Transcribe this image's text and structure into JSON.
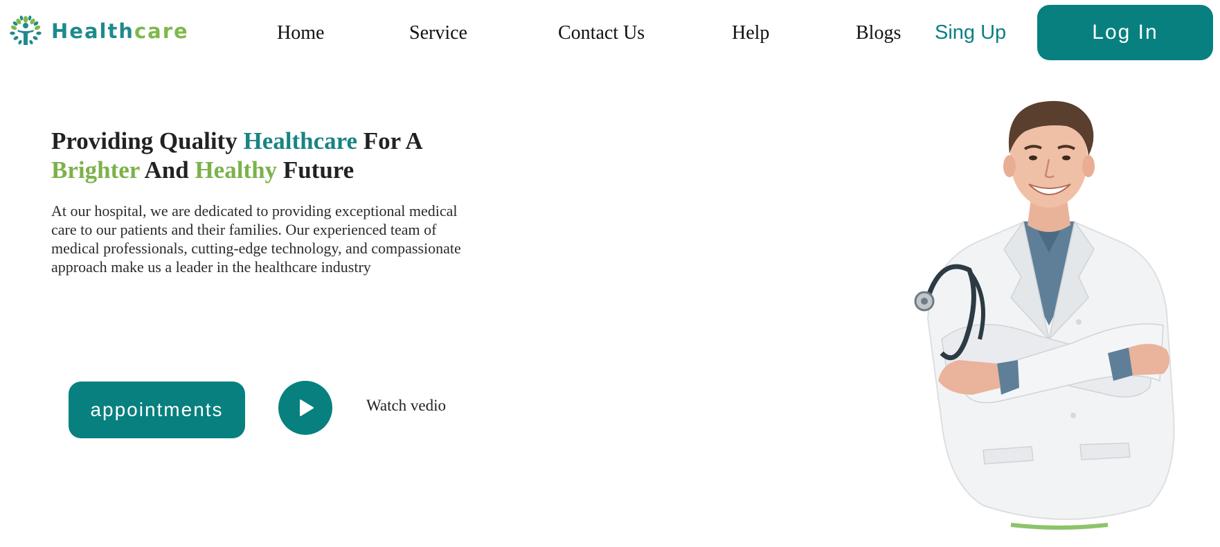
{
  "brand": {
    "name_part1": "Health",
    "name_part2": "care",
    "colors": {
      "teal": "#07807f",
      "green": "#7fb84b"
    }
  },
  "nav": {
    "items": [
      "Home",
      "Service",
      "Contact Us",
      "Help",
      "Blogs"
    ],
    "signup_label": "Sing Up",
    "login_label": "Log In"
  },
  "hero": {
    "headline": {
      "w1": "Providing Quality ",
      "w2": "Healthcare",
      "w3": " For A",
      "w4": "Brighter",
      "w5": " And ",
      "w6": "Healthy",
      "w7": " Future"
    },
    "description": "At our hospital, we are dedicated to providing exceptional medical care to our patients and their families. Our experienced team of medical professionals, cutting-edge technology, and compassionate approach make us a leader in the healthcare industry",
    "appointments_label": "appointments",
    "watch_label": "Watch vedio"
  },
  "icons": {
    "logo": "tree-person-logo-icon",
    "play": "play-icon",
    "doctor": "doctor-photo"
  }
}
